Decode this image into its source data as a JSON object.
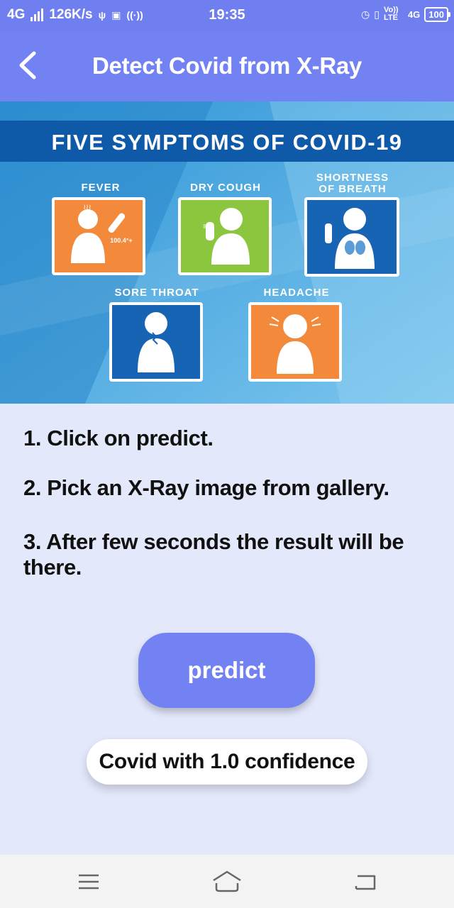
{
  "status_bar": {
    "network": "4G",
    "speed": "126K/s",
    "time": "19:35",
    "volte": "Vo)) LTE",
    "data_type": "4G",
    "battery": "100"
  },
  "app_bar": {
    "title": "Detect Covid from X-Ray",
    "back_icon": "chevron-left-icon"
  },
  "banner": {
    "heading": "FIVE SYMPTOMS OF COVID-19",
    "symptoms": [
      {
        "label": "FEVER",
        "color": "#f2893b"
      },
      {
        "label": "DRY COUGH",
        "color": "#8cc63f"
      },
      {
        "label_line1": "SHORTNESS",
        "label_line2": "OF BREATH",
        "color": "#1864b4"
      },
      {
        "label": "SORE THROAT",
        "color": "#1864b4"
      },
      {
        "label": "HEADACHE",
        "color": "#f2893b"
      }
    ],
    "thermometer_text": "100.4°+"
  },
  "instructions": [
    "1. Click on predict.",
    "2. Pick an X-Ray image from gallery.",
    "3. After few seconds the result will be there."
  ],
  "predict_button": {
    "label": "predict"
  },
  "result": {
    "text": "Covid with 1.0 confidence"
  },
  "nav_bar": {
    "menu_icon": "menu-icon",
    "home_icon": "home-icon",
    "back_icon": "return-icon"
  },
  "colors": {
    "primary": "#7282f2",
    "background": "#e3e8fb",
    "banner_blue": "#3fa7dc",
    "banner_dark": "#0f5aa8"
  }
}
